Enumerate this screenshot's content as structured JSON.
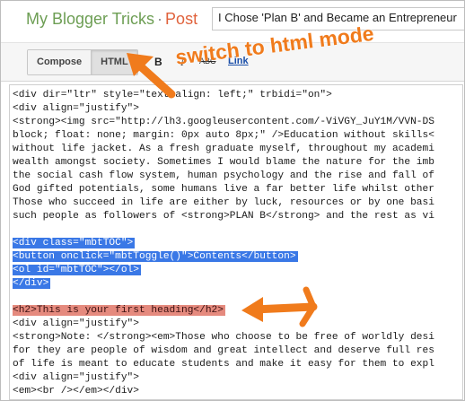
{
  "header": {
    "brand": "My Blogger Tricks",
    "separator": "·",
    "section": "Post",
    "post_title_value": "I Chose 'Plan B' and Became an Entrepreneur"
  },
  "toolbar": {
    "compose_label": "Compose",
    "html_label": "HTML",
    "bold_label": "B",
    "italic_label": "I",
    "strikethrough_label": "ABC",
    "link_label": "Link"
  },
  "annotations": {
    "mode_note": "switch to html mode",
    "arrow_color": "#f07b1c"
  },
  "highlight_colors": {
    "selection": "#3a78e6",
    "heading": "#e58a7e"
  },
  "editor": {
    "lines": [
      "<div dir=\"ltr\" style=\"text-align: left;\" trbidi=\"on\">",
      "<div align=\"justify\">",
      "<strong><img src=\"http://lh3.googleusercontent.com/-ViVGY_JuY1M/VVN-DS",
      "block; float: none; margin: 0px auto 8px;\" />Education without skills<",
      "without life jacket. As a fresh graduate myself, throughout my academi",
      "wealth amongst society. Sometimes I would blame the nature for the imb",
      "the social cash flow system, human psychology and the rise and fall of",
      "God gifted potentials, some humans live a far better life whilst other",
      "Those who succeed in life are either by luck, resources or by one basi",
      "such people as followers of <strong>PLAN B</strong> and the rest as vi",
      "",
      "<div class=\"mbtTOC\">",
      "<button onclick=\"mbtToggle()\">Contents</button>",
      "<ol id=\"mbtTOC\"></ol>",
      "</div>",
      "",
      "<h2>This is your first heading</h2>",
      "<div align=\"justify\">",
      "<strong>Note: </strong><em>Those who choose to be free of worldly desi",
      "for they are people of wisdom and great intellect and deserve full res",
      "of life is meant to educate students and make it easy for them to expl",
      "<div align=\"justify\">",
      "<em><br /></em></div>"
    ]
  }
}
